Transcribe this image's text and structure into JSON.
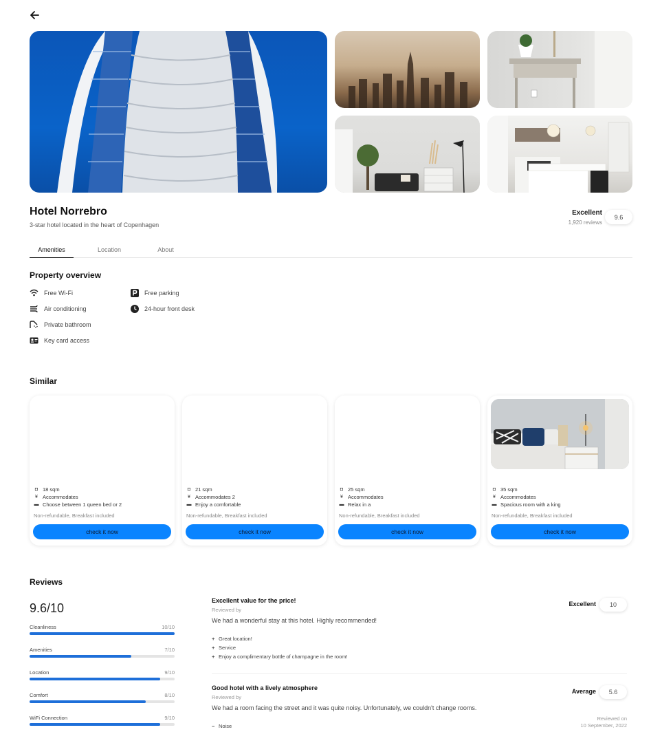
{
  "icons": {
    "back": "arrow-left-icon",
    "wifi": "wifi-icon",
    "ac": "air-conditioning-icon",
    "bath": "shower-icon",
    "key": "key-card-icon",
    "parking": "parking-icon",
    "desk": "clock-icon",
    "size": "ruler-icon",
    "guests": "guests-icon",
    "bed": "bed-icon"
  },
  "hotel": {
    "name": "Hotel Norrebro",
    "subtitle": "3-star hotel located in the heart of Copenhagen",
    "rating_word": "Excellent",
    "reviews_count": "1,920 reviews",
    "score": "9.6"
  },
  "tabs": [
    {
      "label": "Amenities",
      "active": true
    },
    {
      "label": "Location",
      "active": false
    },
    {
      "label": "About",
      "active": false
    }
  ],
  "overview": {
    "title": "Property overview",
    "amenities": [
      {
        "label": "Free Wi-Fi"
      },
      {
        "label": "Air conditioning"
      },
      {
        "label": "Private bathroom"
      },
      {
        "label": "Key card access"
      },
      {
        "label": "Free parking"
      },
      {
        "label": "24-hour front desk"
      }
    ]
  },
  "similar": {
    "title": "Similar",
    "cards": [
      {
        "size": "18 sqm",
        "guests": "Accommodates",
        "bed": "Choose between 1 queen bed or 2",
        "note": "Non-refundable, Breakfast included",
        "button": "check it now"
      },
      {
        "size": "21 sqm",
        "guests": "Accommodates 2",
        "bed": "Enjoy a comfortable",
        "note": "Non-refundable, Breakfast included",
        "button": "check it now"
      },
      {
        "size": "25 sqm",
        "guests": "Accommodates",
        "bed": "Relax in a",
        "note": "Non-refundable, Breakfast included",
        "button": "check it now"
      },
      {
        "size": "35 sqm",
        "guests": "Accommodates",
        "bed": "Spacious room with a king",
        "note": "Non-refundable, Breakfast included",
        "button": "check it now"
      }
    ]
  },
  "reviews": {
    "title": "Reviews",
    "overall": "9.6/10",
    "categories": [
      {
        "label": "Cleanliness",
        "value": "10/10",
        "fraction": 1.0
      },
      {
        "label": "Amenities",
        "value": "7/10",
        "fraction": 0.7
      },
      {
        "label": "Location",
        "value": "9/10",
        "fraction": 0.9
      },
      {
        "label": "Comfort",
        "value": "8/10",
        "fraction": 0.8
      },
      {
        "label": "WiFi Connection",
        "value": "9/10",
        "fraction": 0.9
      }
    ],
    "items": [
      {
        "title": "Excellent value for the price!",
        "by": "Reviewed by",
        "text": "We had a wonderful stay at this hotel. Highly recommended!",
        "rating_word": "Excellent",
        "score": "10",
        "points": [
          {
            "sym": "+",
            "text": "Great location!"
          },
          {
            "sym": "+",
            "text": "Service"
          },
          {
            "sym": "+",
            "text": "Enjoy a complimentary bottle of champagne in the room!"
          }
        ]
      },
      {
        "title": "Good hotel with a lively atmosphere",
        "by": "Reviewed by",
        "text": "We had a room facing the street and it was quite noisy. Unfortunately, we couldn't change rooms.",
        "rating_word": "Average",
        "score": "5.6",
        "points": [
          {
            "sym": "−",
            "text": "Noise"
          }
        ],
        "date_label": "Reviewed on",
        "date": "10 September, 2022"
      }
    ]
  }
}
